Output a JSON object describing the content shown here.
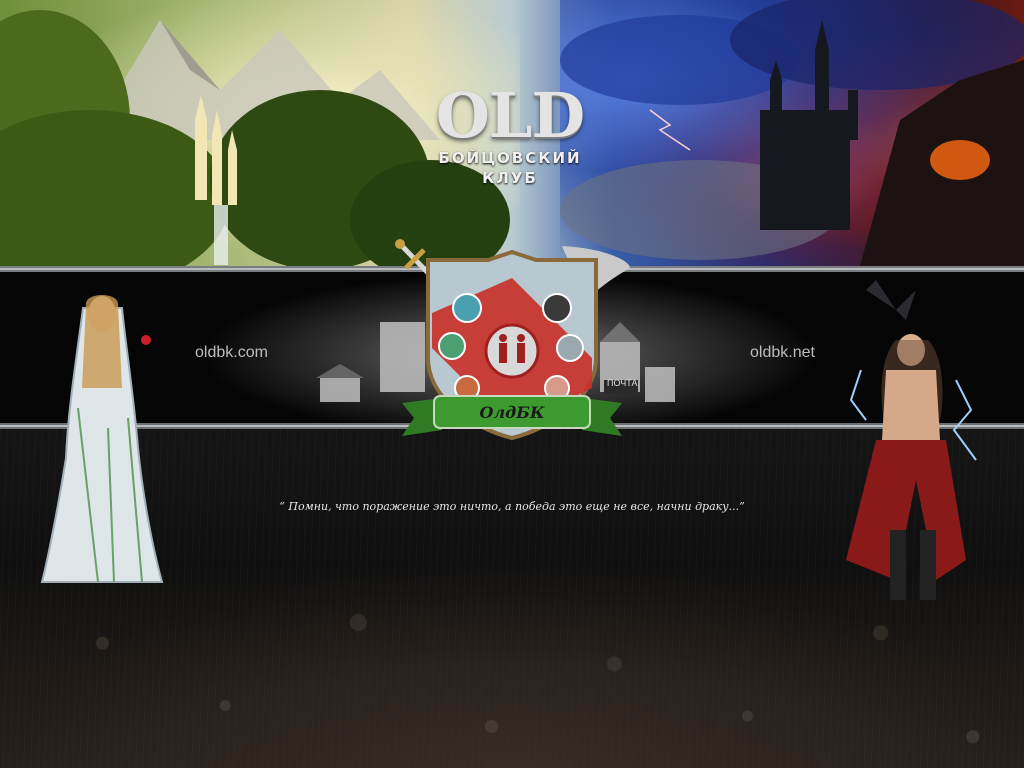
{
  "logo": {
    "title": "OLD",
    "subtitle_line1": "БОЙЦОВСКИЙ",
    "subtitle_line2": "КЛУБ"
  },
  "crest": {
    "banner": "ОлдБК",
    "sign": "ПОЧТА"
  },
  "links": {
    "left_domain": "oldbk.com",
    "right_domain": "oldbk.net"
  },
  "quote": "“ Помни, что поражение это ничто, а победа это еще не все, начни драку...”",
  "colors": {
    "band": "#050505",
    "rail": "#7a7d80",
    "banner_green": "#3d9a2e",
    "crest_red": "#c8322a",
    "crest_silver": "#b8c8d0",
    "text_light": "#e8e8e8"
  },
  "icons": [
    "sword-icon",
    "axe-icon",
    "crest-emblem",
    "elf-mage-character",
    "demon-warrior-character"
  ]
}
